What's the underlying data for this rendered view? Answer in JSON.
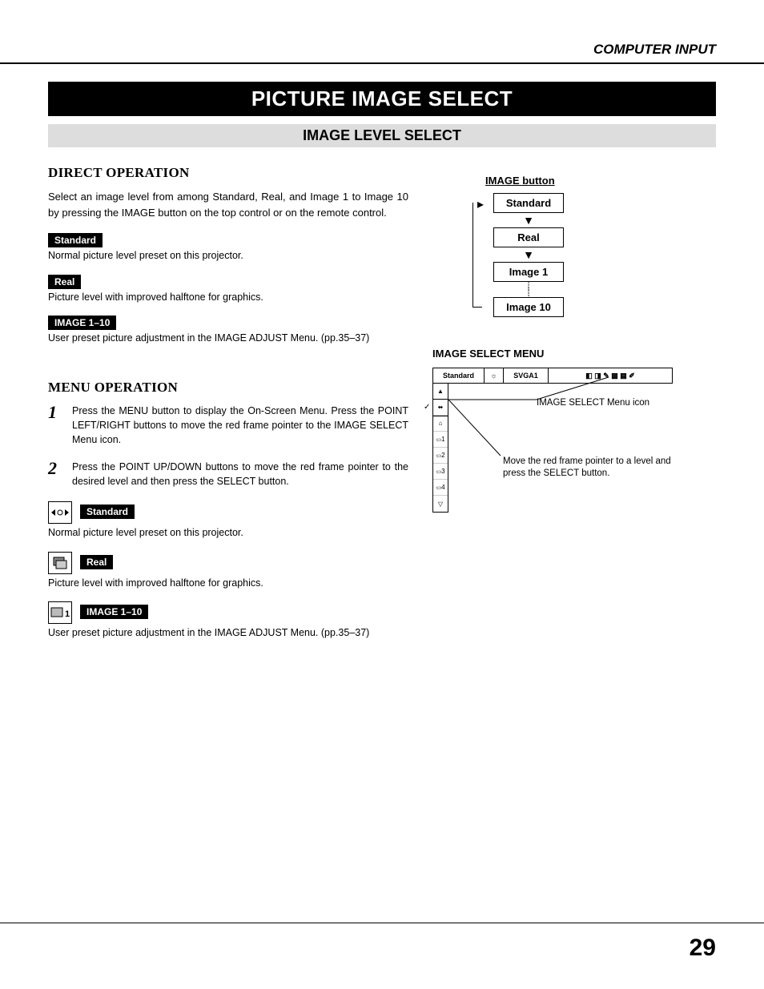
{
  "header": {
    "section": "COMPUTER INPUT"
  },
  "title": "PICTURE IMAGE SELECT",
  "subtitle": "IMAGE LEVEL SELECT",
  "direct_operation": {
    "heading": "DIRECT OPERATION",
    "intro": "Select an image level from among Standard, Real, and Image 1 to Image 10 by pressing the IMAGE button on the top control or on the remote control.",
    "items": [
      {
        "label": "Standard",
        "desc": "Normal picture level preset on this projector."
      },
      {
        "label": "Real",
        "desc": "Picture level with improved halftone for graphics."
      },
      {
        "label": "IMAGE 1–10",
        "desc": "User preset picture adjustment in the IMAGE ADJUST Menu. (pp.35–37)"
      }
    ]
  },
  "menu_operation": {
    "heading": "MENU OPERATION",
    "steps": [
      "Press the MENU button to display the On-Screen Menu. Press the POINT LEFT/RIGHT buttons to move the red frame pointer to the IMAGE SELECT Menu icon.",
      "Press the POINT UP/DOWN buttons to move the red frame pointer to the desired level and then press the SELECT button."
    ],
    "items": [
      {
        "label": "Standard",
        "desc": "Normal picture level preset on this projector."
      },
      {
        "label": "Real",
        "desc": "Picture level with improved halftone for graphics."
      },
      {
        "label": "IMAGE 1–10",
        "desc": "User preset picture adjustment in the IMAGE ADJUST Menu. (pp.35–37)"
      }
    ]
  },
  "flow": {
    "label": "IMAGE button",
    "boxes": [
      "Standard",
      "Real",
      "Image 1",
      "Image 10"
    ]
  },
  "image_select_menu": {
    "caption": "IMAGE SELECT MENU",
    "topbar": {
      "left": "Standard",
      "mid": "SVGA1"
    },
    "side_items": [
      "▲",
      "⬌",
      "⌂",
      "1",
      "2",
      "3",
      "4",
      "▽"
    ],
    "callout1": "IMAGE SELECT Menu icon",
    "callout2": "Move the red frame pointer to a level and press the SELECT button."
  },
  "page_number": "29"
}
